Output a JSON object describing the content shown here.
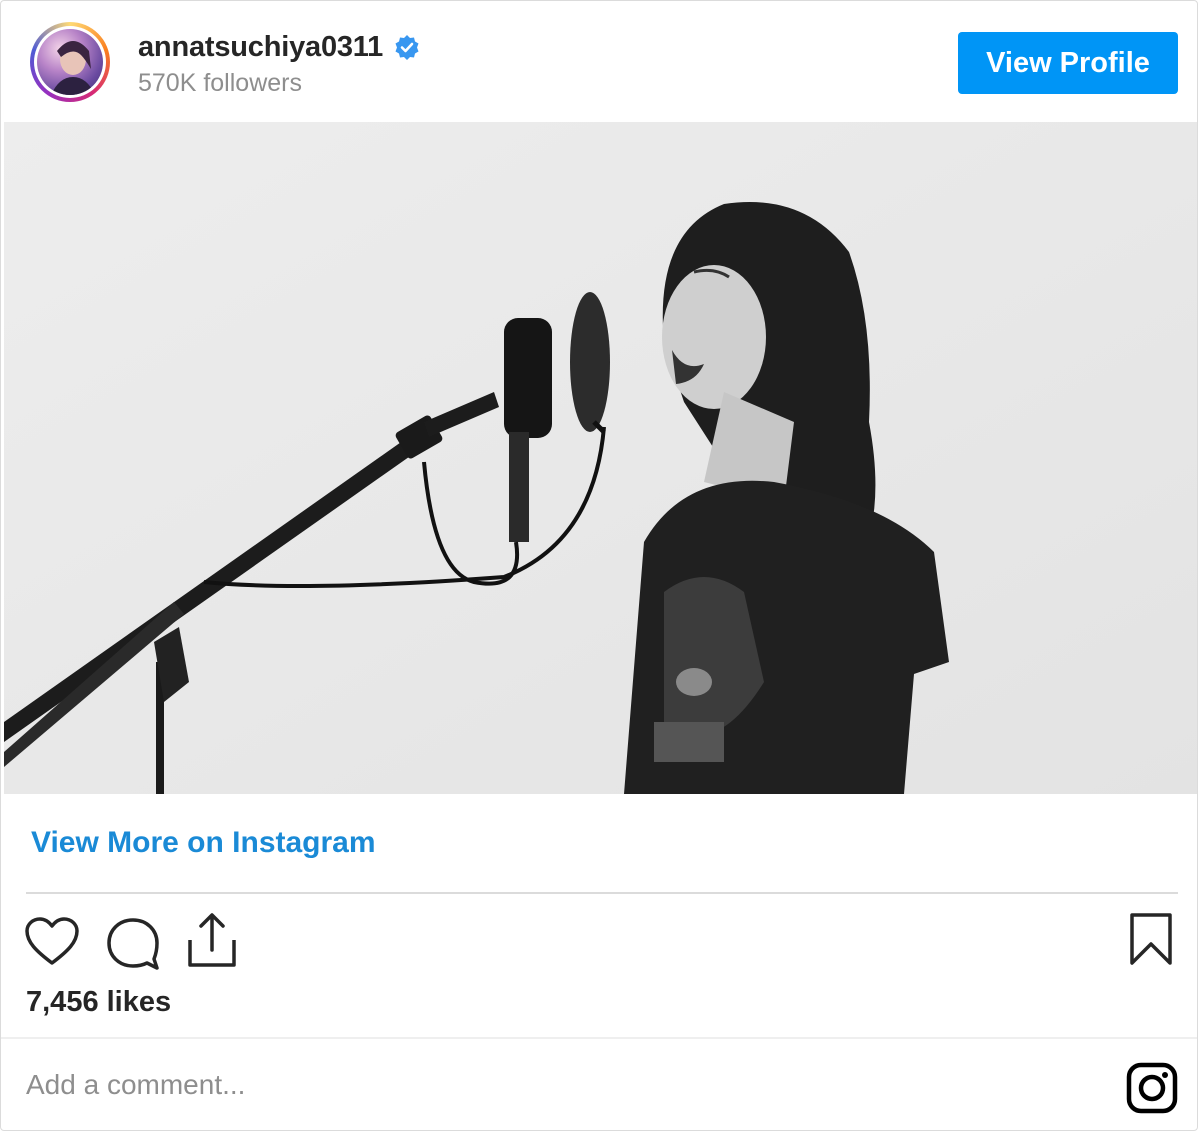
{
  "header": {
    "username": "annatsuchiya0311",
    "followers": "570K followers",
    "view_profile_label": "View Profile"
  },
  "media": {
    "description_icon": "photo"
  },
  "footer": {
    "view_more_label": "View More on Instagram",
    "likes": "7,456 likes",
    "comment_placeholder": "Add a comment..."
  },
  "icons": {
    "verified": "verified-badge-icon",
    "like": "heart-icon",
    "comment": "comment-icon",
    "share": "share-icon",
    "save": "bookmark-icon",
    "brand": "instagram-icon"
  },
  "colors": {
    "accent": "#0095f6",
    "link": "#1a8ad6",
    "muted": "#8e8e8e"
  }
}
